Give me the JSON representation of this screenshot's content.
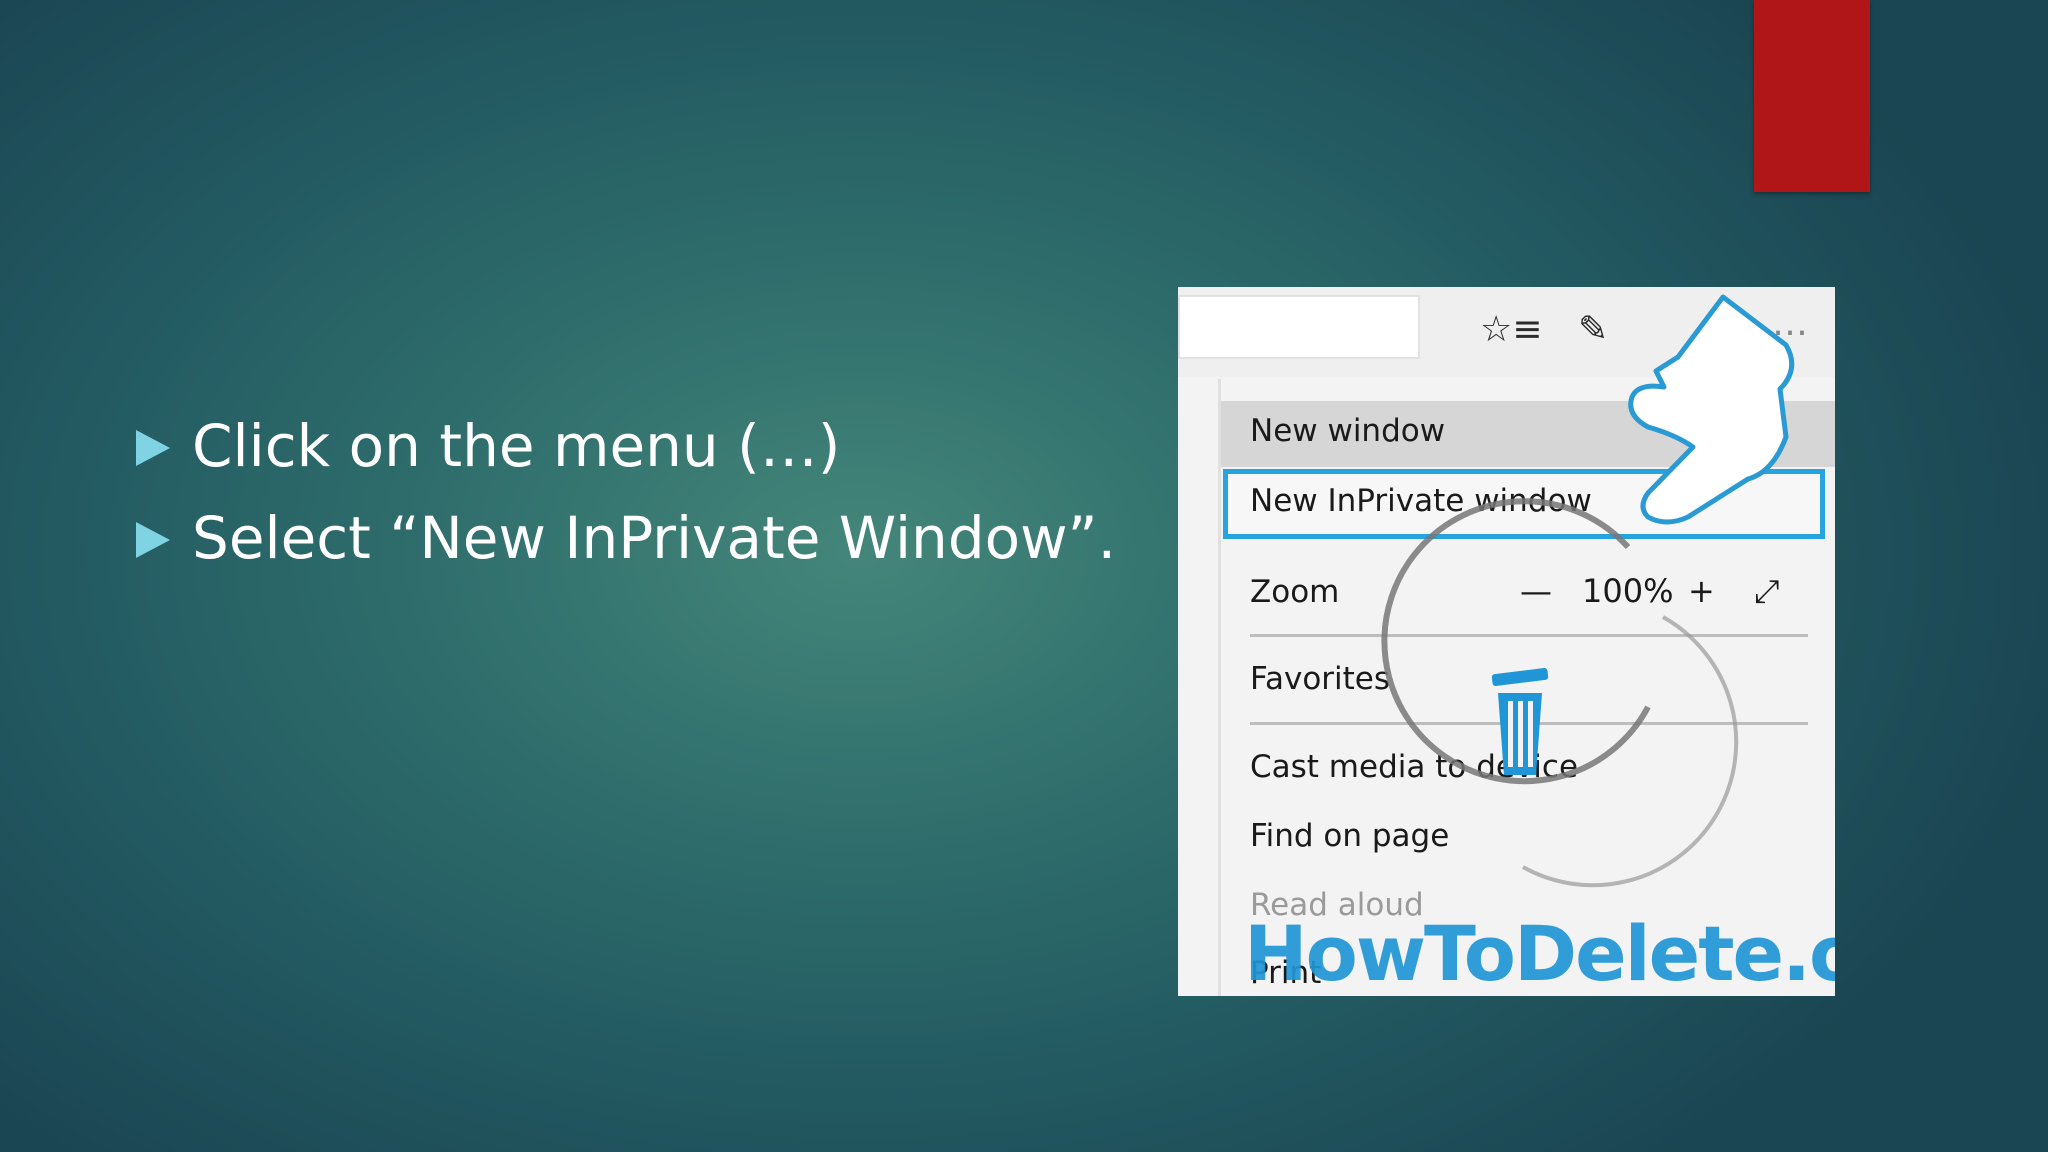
{
  "bullets": [
    {
      "text": "Click on the menu (…)"
    },
    {
      "text": "Select “New InPrivate Window”."
    }
  ],
  "screenshot": {
    "menu_items": {
      "new_window": "New window",
      "new_inprivate": "New InPrivate window",
      "zoom": "Zoom",
      "zoom_value": "100%",
      "favorites": "Favorites",
      "cast_media": "Cast media to device",
      "find_on_page": "Find on page",
      "read_aloud": "Read aloud",
      "print": "Print"
    },
    "zoom_controls": {
      "minus": "—",
      "plus": "+",
      "expand": "⤢"
    },
    "toolbar_icons": [
      "favorites-list-icon",
      "pen-icon",
      "more-dots-icon"
    ],
    "watermark": "HowToDelete.org"
  },
  "colors": {
    "accent_red": "#b01617",
    "bullet_arrow": "#7fd3e3",
    "selection_blue": "#27a3e0",
    "watermark_blue": "#2196d6"
  }
}
